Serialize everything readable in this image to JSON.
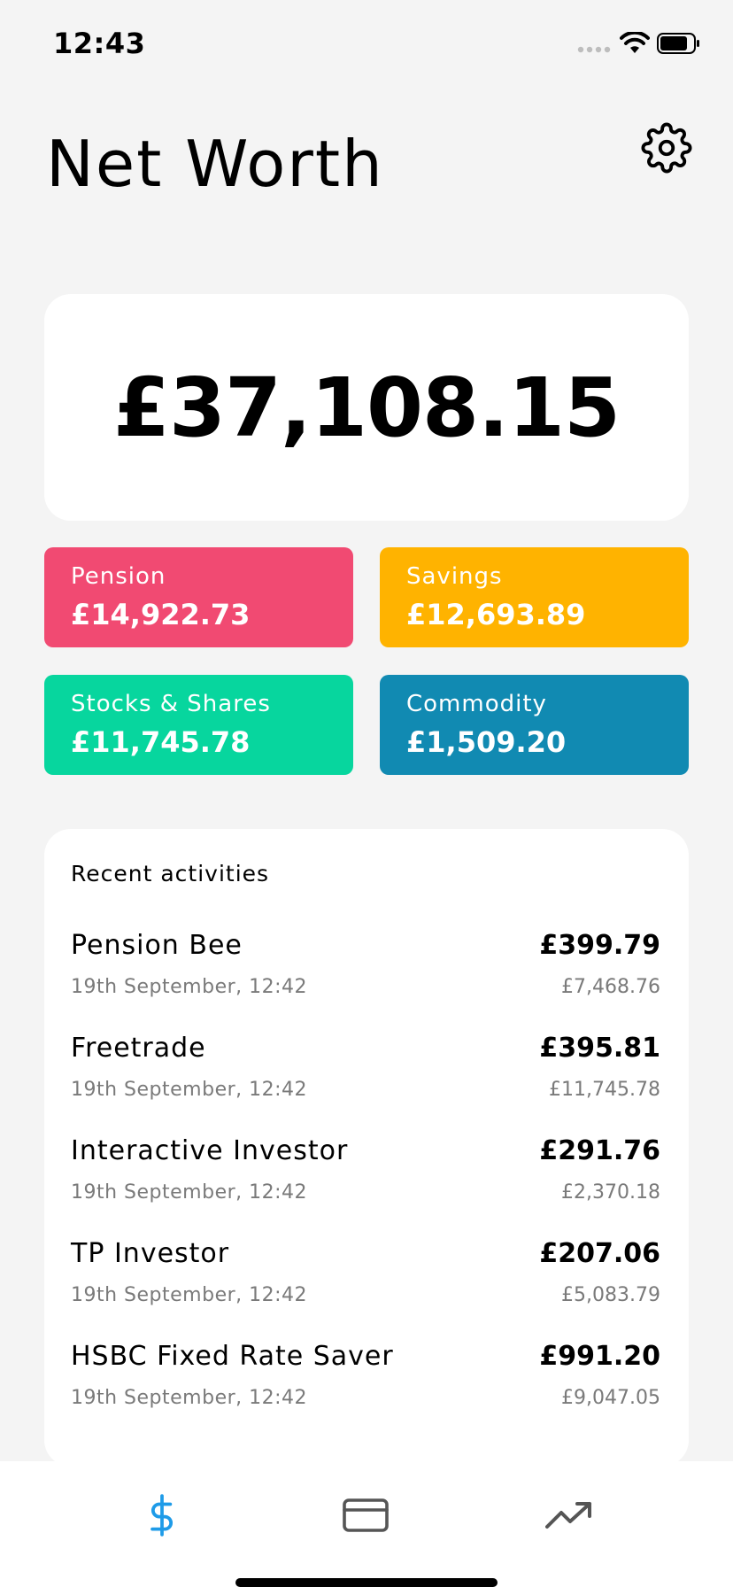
{
  "status_bar": {
    "time": "12:43"
  },
  "header": {
    "title": "Net Worth",
    "settings_icon": "gear-icon"
  },
  "summary": {
    "total": "£37,108.15"
  },
  "categories": [
    {
      "label": "Pension",
      "value": "£14,922.73",
      "color": "#f14a72"
    },
    {
      "label": "Savings",
      "value": "£12,693.89",
      "color": "#ffb300"
    },
    {
      "label": "Stocks & Shares",
      "value": "£11,745.78",
      "color": "#07d69e"
    },
    {
      "label": "Commodity",
      "value": "£1,509.20",
      "color": "#118ab2"
    }
  ],
  "activities": {
    "title": "Recent activities",
    "items": [
      {
        "name": "Pension Bee",
        "date": "19th September, 12:42",
        "amount": "£399.79",
        "balance": "£7,468.76"
      },
      {
        "name": "Freetrade",
        "date": "19th September, 12:42",
        "amount": "£395.81",
        "balance": "£11,745.78"
      },
      {
        "name": "Interactive Investor",
        "date": "19th September, 12:42",
        "amount": "£291.76",
        "balance": "£2,370.18"
      },
      {
        "name": "TP Investor",
        "date": "19th September, 12:42",
        "amount": "£207.06",
        "balance": "£5,083.79"
      },
      {
        "name": "HSBC Fixed Rate Saver",
        "date": "19th September, 12:42",
        "amount": "£991.20",
        "balance": "£9,047.05"
      }
    ]
  },
  "tab_bar": {
    "tabs": [
      {
        "icon": "dollar-icon",
        "active": true
      },
      {
        "icon": "credit-card-icon",
        "active": false
      },
      {
        "icon": "trending-up-icon",
        "active": false
      }
    ],
    "active_color": "#1e9be8",
    "inactive_color": "#555555"
  }
}
